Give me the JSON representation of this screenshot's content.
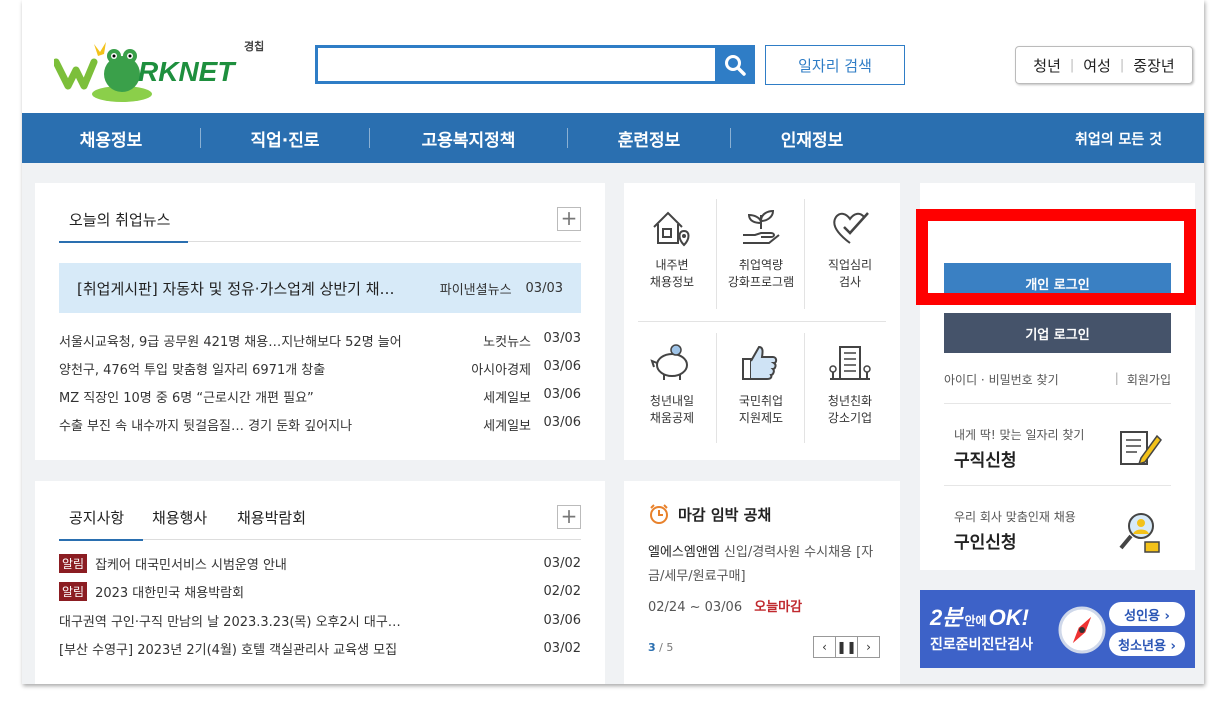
{
  "header": {
    "logo_text": "RKNET",
    "logo_sub": "경칩",
    "search": {
      "value": "",
      "placeholder": ""
    },
    "job_search_label": "일자리 검색",
    "quick_links": [
      "청년",
      "여성",
      "중장년"
    ]
  },
  "nav": {
    "items": [
      "채용정보",
      "직업·진로",
      "고용복지정책",
      "훈련정보",
      "인재정보"
    ],
    "right": "취업의 모든 것"
  },
  "news": {
    "tab": "오늘의 취업뉴스",
    "headline": {
      "title": "[취업게시판] 자동차 및 정유·가스업계 상반기 채…",
      "source": "파이낸셜뉴스",
      "date": "03/03"
    },
    "items": [
      {
        "title": "서울시교육청, 9급 공무원 421명 채용…지난해보다 52명 늘어",
        "source": "노컷뉴스",
        "date": "03/03"
      },
      {
        "title": "양천구, 476억 투입 맞춤형 일자리 6971개 창출",
        "source": "아시아경제",
        "date": "03/06"
      },
      {
        "title": "MZ 직장인 10명 중 6명 “근로시간 개편 필요”",
        "source": "세계일보",
        "date": "03/06"
      },
      {
        "title": "수출 부진 속 내수까지 뒷걸음질… 경기 둔화 깊어지나",
        "source": "세계일보",
        "date": "03/06"
      }
    ]
  },
  "notice": {
    "tabs": [
      "공지사항",
      "채용행사",
      "채용박람회"
    ],
    "items": [
      {
        "badge": "알림",
        "title": "잡케어 대국민서비스 시범운영 안내",
        "date": "03/02"
      },
      {
        "badge": "알림",
        "title": "2023 대한민국 채용박람회",
        "date": "02/02"
      },
      {
        "badge": "",
        "title": "대구권역 구인·구직 만남의 날 2023.3.23(목) 오후2시 대구…",
        "date": "03/06"
      },
      {
        "badge": "",
        "title": "[부산 수영구] 2023년 2기(4월) 호텔 객실관리사 교육생 모집",
        "date": "03/02"
      }
    ]
  },
  "services": [
    {
      "line1": "내주변",
      "line2": "채용정보",
      "icon": "house-location-icon"
    },
    {
      "line1": "취업역량",
      "line2": "강화프로그램",
      "icon": "sprout-hand-icon"
    },
    {
      "line1": "직업심리",
      "line2": "검사",
      "icon": "heart-check-icon"
    },
    {
      "line1": "청년내일",
      "line2": "채움공제",
      "icon": "piggy-bank-icon"
    },
    {
      "line1": "국민취업",
      "line2": "지원제도",
      "icon": "thumbs-up-icon"
    },
    {
      "line1": "청년친화",
      "line2": "강소기업",
      "icon": "building-icon"
    }
  ],
  "deadline": {
    "title": "마감 임박 공채",
    "company": "엘에스엠앤엠",
    "desc": "신입/경력사원 수시채용 [자금/세무/원료구매]",
    "date_range": "02/24 ~ 03/06",
    "status": "오늘마감",
    "page_current": "3",
    "page_total": "/ 5"
  },
  "login": {
    "personal": "개인 로그인",
    "corporate": "기업 로그인",
    "find": "아이디 · 비밀번호 찾기",
    "join": "회원가입",
    "cards": [
      {
        "sub": "내게 딱! 맞는 일자리 찾기",
        "main": "구직신청",
        "icon": "resume-pen-icon"
      },
      {
        "sub": "우리 회사 맞춤인재 채용",
        "main": "구인신청",
        "icon": "magnifier-person-icon"
      }
    ]
  },
  "banner": {
    "big_a": "2분",
    "big_small": "안에",
    "big_b": "OK!",
    "sub": "진로준비진단검사",
    "adult": "성인용 ›",
    "youth": "청소년용 ›"
  },
  "colors": {
    "primary": "#2a6fb0",
    "highlight": "#ff0000",
    "alert": "#8b1d22"
  }
}
